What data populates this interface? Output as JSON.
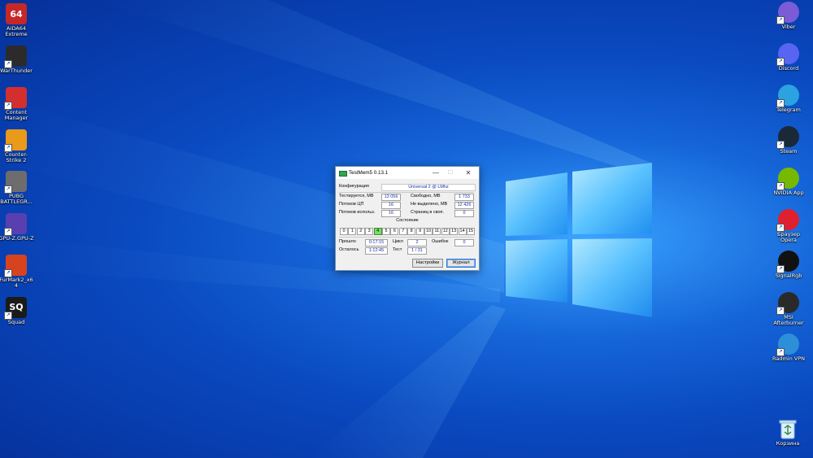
{
  "desktop": {
    "left_icons": [
      {
        "label": "AIDA64 Extreme",
        "icon": "aida64-icon",
        "glyph": "64",
        "color": "#c62828"
      },
      {
        "label": "WarThunder",
        "icon": "warthunder-icon",
        "glyph": "",
        "color": "#2b2b2b"
      },
      {
        "label": "Content Manager",
        "icon": "content-manager-icon",
        "glyph": "",
        "color": "#d32f2f"
      },
      {
        "label": "Counter-Strike 2",
        "icon": "counter-strike-icon",
        "glyph": "",
        "color": "#e89a1a"
      },
      {
        "label": "PUBG BATTLEGR...",
        "icon": "pubg-icon",
        "glyph": "",
        "color": "#6d6d6d"
      },
      {
        "label": "GPU-Z.GPU-Z",
        "icon": "gpuz-icon",
        "glyph": "",
        "color": "#5a3fb0"
      },
      {
        "label": "FurMark2_x64",
        "icon": "furmark-icon",
        "glyph": "",
        "color": "#d8431f"
      },
      {
        "label": "Squad",
        "icon": "squad-icon",
        "glyph": "SQ",
        "color": "#1b1b1b"
      }
    ],
    "right_icons": [
      {
        "label": "Viber",
        "icon": "viber-icon",
        "color": "#7b5cd6"
      },
      {
        "label": "Discord",
        "icon": "discord-icon",
        "color": "#5865f2"
      },
      {
        "label": "Telegram",
        "icon": "telegram-icon",
        "color": "#2aa3e0"
      },
      {
        "label": "Steam",
        "icon": "steam-icon",
        "color": "#1b2838"
      },
      {
        "label": "NVIDIA App",
        "icon": "nvidia-icon",
        "color": "#76b900"
      },
      {
        "label": "Браузер Opera",
        "icon": "opera-icon",
        "color": "#e0202f"
      },
      {
        "label": "SignalRgb",
        "icon": "signalrgb-icon",
        "color": "#111111"
      },
      {
        "label": "MSI Afterburner",
        "icon": "msi-afterburner-icon",
        "color": "#2a2a2a"
      },
      {
        "label": "Radmin VPN",
        "icon": "radmin-vpn-icon",
        "color": "#2d8fd8"
      }
    ],
    "recycle_bin": {
      "label": "Корзина",
      "icon": "recycle-bin-icon"
    }
  },
  "window": {
    "title": "TestMem5  0.13.1",
    "minimize": "—",
    "maximize": "☐",
    "close": "✕",
    "config_label": "Конфигурация",
    "config_value": "Universal 2 @ LMhz",
    "tested_label": "Тестируется, MB",
    "tested_value": "13 056",
    "free_label": "Свободно, MB",
    "free_value": "1 733",
    "cpu_threads_label": "Потоков ЦП",
    "cpu_threads_value": "16",
    "unallocated_label": "Не выделено, MB",
    "unallocated_value": "12 426",
    "used_threads_label": "Потоков использ.",
    "used_threads_value": "16",
    "swap_pages_label": "Страниц в своп.",
    "swap_pages_value": "0",
    "state_label": "Состояние",
    "state_cells": [
      "0",
      "1",
      "2",
      "3",
      "4",
      "5",
      "6",
      "7",
      "8",
      "9",
      "10",
      "11",
      "12",
      "13",
      "14",
      "15"
    ],
    "state_active_index": 4,
    "elapsed_label": "Прошло",
    "elapsed_value": "0:17:15",
    "cycle_label": "Цикл",
    "cycle_value": "2",
    "errors_label": "Ошибок",
    "errors_value": "0",
    "remaining_label": "Осталось",
    "remaining_value": "1:12:45",
    "test_label": "Тест",
    "test_value": "1 / 31",
    "settings_button": "Настройки",
    "log_button": "Журнал"
  }
}
